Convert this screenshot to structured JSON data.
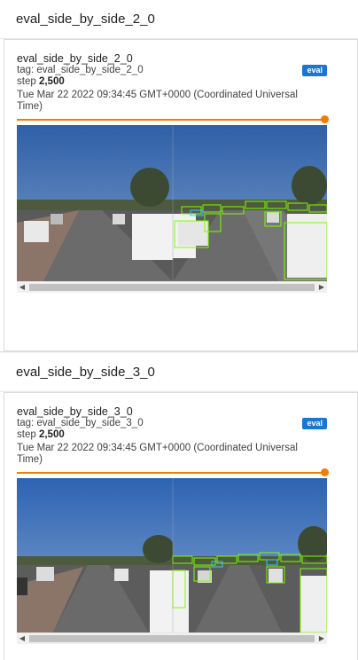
{
  "groups": [
    {
      "header": "eval_side_by_side_2_0",
      "card": {
        "run_name": "eval_side_by_side_2_0",
        "badge": "eval",
        "tag_label": "tag:",
        "tag_value": "eval_side_by_side_2_0",
        "step_label": "step",
        "step_value": "2,500",
        "timestamp": "Tue Mar 22 2022 09:34:45 GMT+0000 (Coordinated Universal Time)",
        "step_slider_fraction": 1.0
      }
    },
    {
      "header": "eval_side_by_side_3_0",
      "card": {
        "run_name": "eval_side_by_side_3_0",
        "badge": "eval",
        "tag_label": "tag:",
        "tag_value": "eval_side_by_side_3_0",
        "step_label": "step",
        "step_value": "2,500",
        "timestamp": "Tue Mar 22 2022 09:34:45 GMT+0000 (Coordinated Universal Time)",
        "step_slider_fraction": 1.0
      }
    }
  ],
  "icons": {
    "scroll_left": "scroll-left-arrow-icon",
    "scroll_right": "scroll-right-arrow-icon"
  },
  "colors": {
    "accent": "#f57c00",
    "badge": "#1976d2",
    "box_green": "#7cfc00"
  }
}
